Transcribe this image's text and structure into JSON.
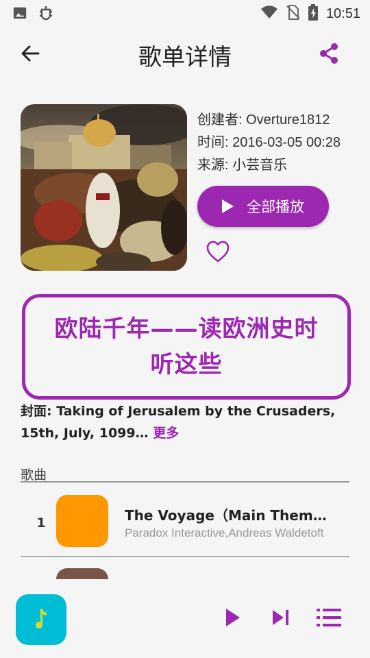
{
  "status_bar": {
    "time": "10:51"
  },
  "app_bar": {
    "title": "歌单详情"
  },
  "playlist": {
    "creator": "创建者: Overture1812",
    "time": "时间: 2016-03-05 00:28",
    "source": "来源: 小芸音乐",
    "play_all_label": "全部播放",
    "title": "欧陆千年——读欧洲史时听这些",
    "cover_description": "封面: Taking of Jerusalem by the Crusaders, 15th, July, 1099…",
    "more_label": "更多"
  },
  "songs_section": {
    "header": "歌曲",
    "songs": [
      {
        "index": "1",
        "title": "The Voyage（Main Theme）...",
        "artist": "Paradox Interactive,Andreas Waldetoft"
      }
    ]
  },
  "colors": {
    "accent": "#9c27b0",
    "thumb1": "#ff9800",
    "thumb2": "#795548",
    "now_playing": "#00bcd4",
    "note": "#cddc39"
  },
  "icons": [
    "image-icon",
    "bug-icon",
    "wifi-icon",
    "no-sim-icon",
    "battery-icon",
    "back-arrow-icon",
    "share-icon",
    "play-icon",
    "heart-icon",
    "music-note-icon",
    "skip-next-icon",
    "playlist-icon"
  ]
}
